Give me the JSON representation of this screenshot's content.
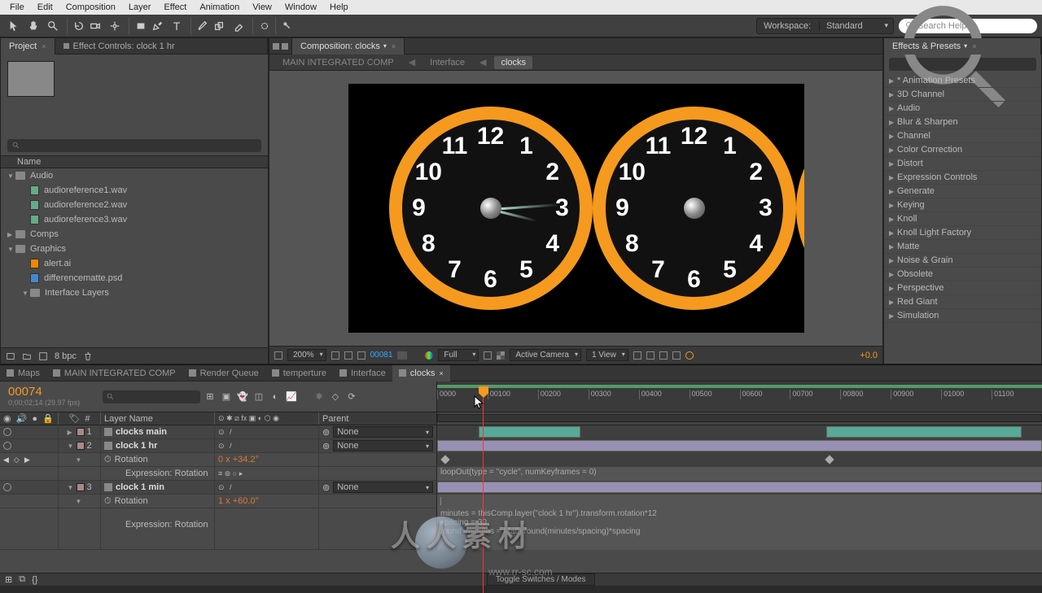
{
  "menu": [
    "File",
    "Edit",
    "Composition",
    "Layer",
    "Effect",
    "Animation",
    "View",
    "Window",
    "Help"
  ],
  "workspace": {
    "label": "Workspace:",
    "value": "Standard"
  },
  "search_help": "Search Help",
  "project": {
    "tab": "Project",
    "ec_tab": "Effect Controls: clock 1 hr",
    "col_name": "Name",
    "tree": [
      {
        "type": "folder",
        "name": "Audio",
        "depth": 0,
        "tw": "▼"
      },
      {
        "type": "wav",
        "name": "audioreference1.wav",
        "depth": 1
      },
      {
        "type": "wav",
        "name": "audioreference2.wav",
        "depth": 1
      },
      {
        "type": "wav",
        "name": "audioreference3.wav",
        "depth": 1
      },
      {
        "type": "folder",
        "name": "Comps",
        "depth": 0,
        "tw": "▶"
      },
      {
        "type": "folder",
        "name": "Graphics",
        "depth": 0,
        "tw": "▼"
      },
      {
        "type": "ai",
        "name": "alert.ai",
        "depth": 1
      },
      {
        "type": "psd",
        "name": "differencematte.psd",
        "depth": 1
      },
      {
        "type": "folder",
        "name": "Interface Layers",
        "depth": 1,
        "tw": "▼"
      }
    ],
    "bpc": "8 bpc"
  },
  "comp": {
    "tab": "Composition: clocks",
    "breadcrumb": [
      "MAIN INTEGRATED COMP",
      "Interface",
      "clocks"
    ],
    "zoom": "200%",
    "frame": "00081",
    "res": "Full",
    "camera": "Active Camera",
    "views": "1 View",
    "exposure": "+0.0"
  },
  "effects": {
    "tab": "Effects & Presets",
    "items": [
      "* Animation Presets",
      "3D Channel",
      "Audio",
      "Blur & Sharpen",
      "Channel",
      "Color Correction",
      "Distort",
      "Expression Controls",
      "Generate",
      "Keying",
      "Knoll",
      "Knoll Light Factory",
      "Matte",
      "Noise & Grain",
      "Obsolete",
      "Perspective",
      "Red Giant",
      "Simulation"
    ]
  },
  "timeline": {
    "tabs": [
      "Maps",
      "MAIN INTEGRATED COMP",
      "Render Queue",
      "temperture",
      "Interface",
      "clocks"
    ],
    "active_tab": 5,
    "timecode": "00074",
    "timecode_sub": "0;00;02;14 (29.97 fps)",
    "ruler": [
      "0000",
      "00100",
      "00200",
      "00300",
      "00400",
      "00500",
      "00600",
      "00700",
      "00800",
      "00900",
      "01000",
      "01100"
    ],
    "col_layer": "Layer Name",
    "col_parent": "Parent",
    "none": "None",
    "layers": [
      {
        "num": "1",
        "name": "clocks main",
        "parent": "None"
      },
      {
        "num": "2",
        "name": "clock 1 hr",
        "parent": "None"
      },
      {
        "num": "3",
        "name": "clock 1 min",
        "parent": "None"
      }
    ],
    "rotation": "Rotation",
    "expr_rotation": "Expression: Rotation",
    "rot_val_1": "0 x +34.2°",
    "rot_val_2": "1 x +60.0°",
    "loop_expr": "loopOut(type = \"cycle\", numKeyframes = 0)",
    "expr_lines": "minutes = thisComp.layer(\"clock 1 hr\").transform.rotation*12\nspacing = 30\nround_minutes = Math.round(minutes/spacing)*spacing",
    "toggle": "Toggle Switches / Modes"
  },
  "watermark": "人人素材",
  "watermark_url": "www.rr-sc.com",
  "clock_numbers": [
    "12",
    "1",
    "2",
    "3",
    "4",
    "5",
    "6",
    "7",
    "8",
    "9",
    "10",
    "11"
  ]
}
